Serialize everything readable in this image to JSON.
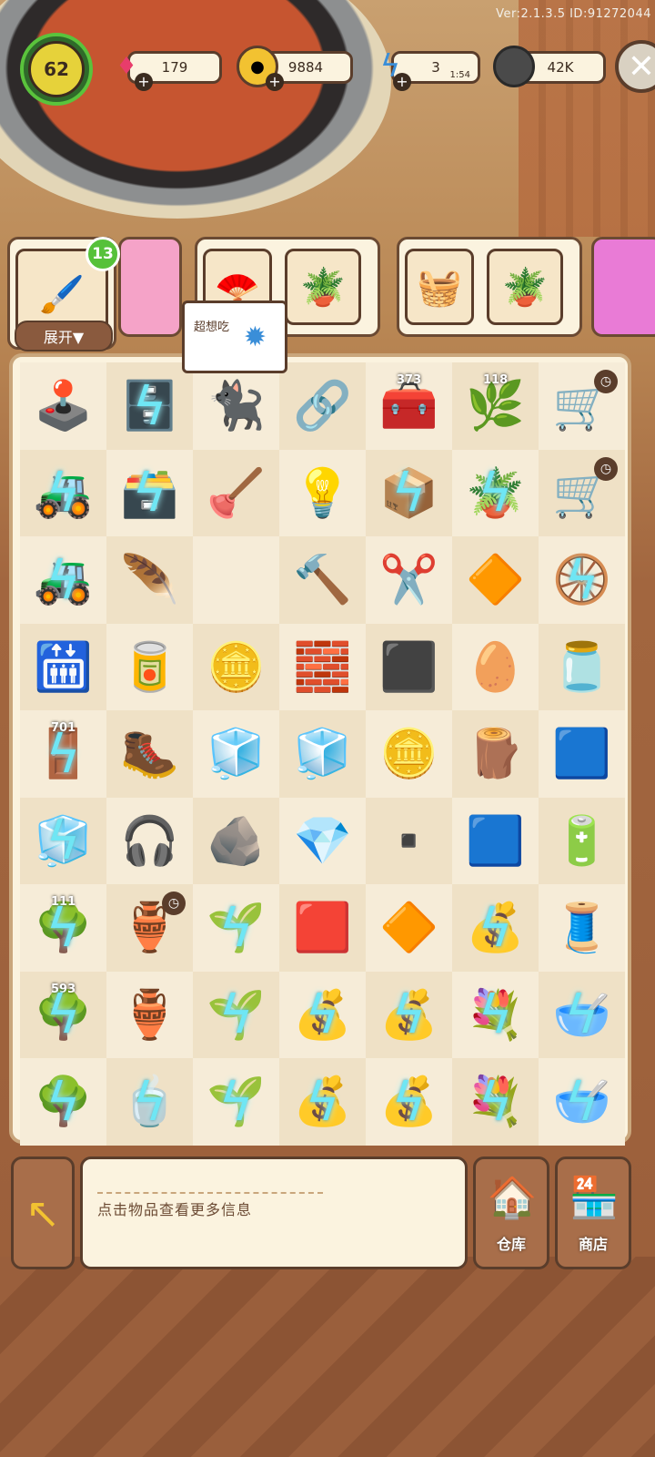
{
  "version_text": "Ver:2.1.3.5 ID:91272044",
  "player": {
    "level": "62"
  },
  "resources": [
    {
      "name": "gems",
      "icon": "gem-icon",
      "value": "179",
      "color": "#e83d6b"
    },
    {
      "name": "coins",
      "icon": "coin-icon",
      "value": "9884",
      "color": "#f2c231"
    },
    {
      "name": "energy",
      "icon": "lightning-icon",
      "value": "3",
      "timer": "1:54",
      "color": "#3a8ed8"
    },
    {
      "name": "seeds",
      "icon": "sunflower-seed-icon",
      "value": "42K",
      "color": "#4a4a4a"
    }
  ],
  "orders": {
    "badge": "13",
    "expand_label": "展开▼",
    "bubble_text": "超想吃"
  },
  "board": {
    "cells": [
      {
        "icon": "🕹️",
        "locked": false
      },
      {
        "icon": "🗄️",
        "locked": true
      },
      {
        "icon": "🐈‍⬛",
        "locked": false
      },
      {
        "icon": "🔗",
        "locked": false
      },
      {
        "icon": "🧰",
        "locked": false,
        "counter": "373"
      },
      {
        "icon": "🌿",
        "locked": false,
        "counter": "118"
      },
      {
        "icon": "🛒",
        "locked": false,
        "clock": true
      },
      {
        "icon": "🚜",
        "locked": true
      },
      {
        "icon": "🗃️",
        "locked": true
      },
      {
        "icon": "🪠",
        "locked": false
      },
      {
        "icon": "💡",
        "locked": false
      },
      {
        "icon": "📦",
        "locked": true
      },
      {
        "icon": "🪴",
        "locked": true
      },
      {
        "icon": "🛒",
        "locked": false,
        "clock": true
      },
      {
        "icon": "🚜",
        "locked": true
      },
      {
        "icon": "🪶",
        "locked": false
      },
      {
        "icon": "",
        "locked": false
      },
      {
        "icon": "🔨",
        "locked": false
      },
      {
        "icon": "✂️",
        "locked": false
      },
      {
        "icon": "🔶",
        "locked": false
      },
      {
        "icon": "🛞",
        "locked": true
      },
      {
        "icon": "🛗",
        "locked": false
      },
      {
        "icon": "🥫",
        "locked": false
      },
      {
        "icon": "🪙",
        "locked": false
      },
      {
        "icon": "🧱",
        "locked": false
      },
      {
        "icon": "⬛",
        "locked": false
      },
      {
        "icon": "🥚",
        "locked": false
      },
      {
        "icon": "🫙",
        "locked": false
      },
      {
        "icon": "🚪",
        "locked": true,
        "counter": "701"
      },
      {
        "icon": "🥾",
        "locked": false
      },
      {
        "icon": "🧊",
        "locked": false
      },
      {
        "icon": "🧊",
        "locked": false
      },
      {
        "icon": "🪙",
        "locked": false
      },
      {
        "icon": "🪵",
        "locked": false
      },
      {
        "icon": "🟦",
        "locked": false
      },
      {
        "icon": "🧊",
        "locked": true
      },
      {
        "icon": "🎧",
        "locked": false
      },
      {
        "icon": "🪨",
        "locked": false
      },
      {
        "icon": "💎",
        "locked": false
      },
      {
        "icon": "▪️",
        "locked": false
      },
      {
        "icon": "🟦",
        "locked": false
      },
      {
        "icon": "🔋",
        "locked": false
      },
      {
        "icon": "🌳",
        "locked": true,
        "counter": "111"
      },
      {
        "icon": "🏺",
        "locked": false,
        "clock": true
      },
      {
        "icon": "🌱",
        "locked": true
      },
      {
        "icon": "🟥",
        "locked": false
      },
      {
        "icon": "🔶",
        "locked": false
      },
      {
        "icon": "💰",
        "locked": true
      },
      {
        "icon": "🧵",
        "locked": false
      },
      {
        "icon": "🌳",
        "locked": true,
        "counter": "593"
      },
      {
        "icon": "🏺",
        "locked": false
      },
      {
        "icon": "🌱",
        "locked": true
      },
      {
        "icon": "💰",
        "locked": true
      },
      {
        "icon": "💰",
        "locked": true
      },
      {
        "icon": "💐",
        "locked": true
      },
      {
        "icon": "🥣",
        "locked": true
      },
      {
        "icon": "🌳",
        "locked": true
      },
      {
        "icon": "🍵",
        "locked": true
      },
      {
        "icon": "🌱",
        "locked": true
      },
      {
        "icon": "💰",
        "locked": true
      },
      {
        "icon": "💰",
        "locked": true
      },
      {
        "icon": "💐",
        "locked": true
      },
      {
        "icon": "🥣",
        "locked": true
      }
    ]
  },
  "bottom": {
    "info_text": "点击物品查看更多信息",
    "warehouse_label": "仓库",
    "shop_label": "商店"
  }
}
